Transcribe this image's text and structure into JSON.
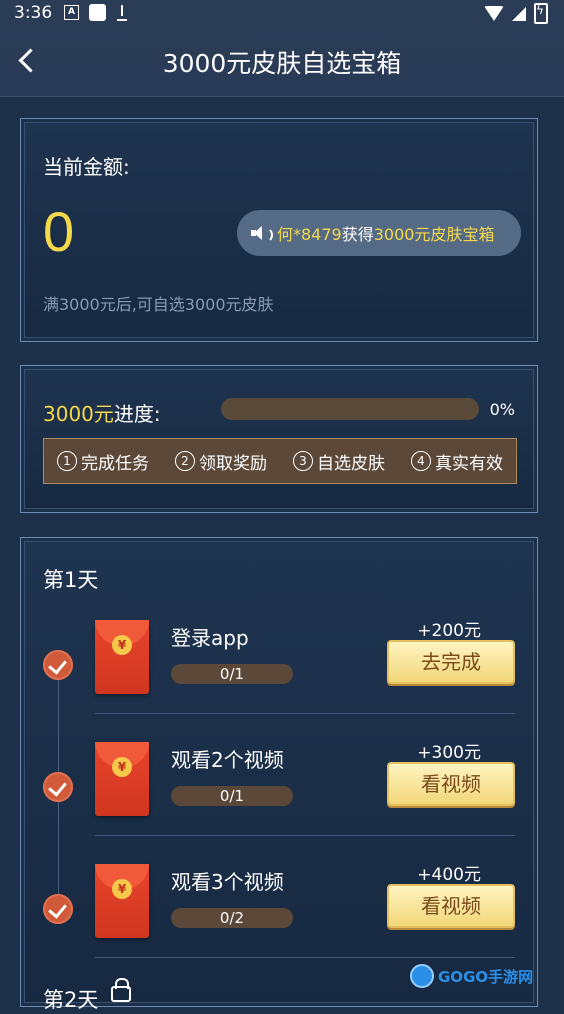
{
  "status_bar": {
    "time": "3:36",
    "icon_a": "A"
  },
  "nav": {
    "title": "3000元皮肤自选宝箱"
  },
  "balance": {
    "label": "当前金额:",
    "value": "0",
    "note": "满3000元后,可自选3000元皮肤",
    "ticker_user": "何*8479",
    "ticker_mid": "获得",
    "ticker_prize": "3000元皮肤宝箱"
  },
  "progress": {
    "amount": "3000元",
    "label": "进度:",
    "percent_text": "0%",
    "fraction": 0,
    "steps": [
      {
        "num": "1",
        "label": "完成任务"
      },
      {
        "num": "2",
        "label": "领取奖励"
      },
      {
        "num": "3",
        "label": "自选皮肤"
      },
      {
        "num": "4",
        "label": "真实有效"
      }
    ]
  },
  "tasks": {
    "day1_title": "第1天",
    "day2_title": "第2天",
    "items": [
      {
        "name": "登录app",
        "progress": "0/1",
        "reward": "+200元",
        "button": "去完成"
      },
      {
        "name": "观看2个视频",
        "progress": "0/1",
        "reward": "+300元",
        "button": "看视频"
      },
      {
        "name": "观看3个视频",
        "progress": "0/2",
        "reward": "+400元",
        "button": "看视频"
      }
    ]
  },
  "watermark": {
    "text": "GOGO手游网"
  }
}
